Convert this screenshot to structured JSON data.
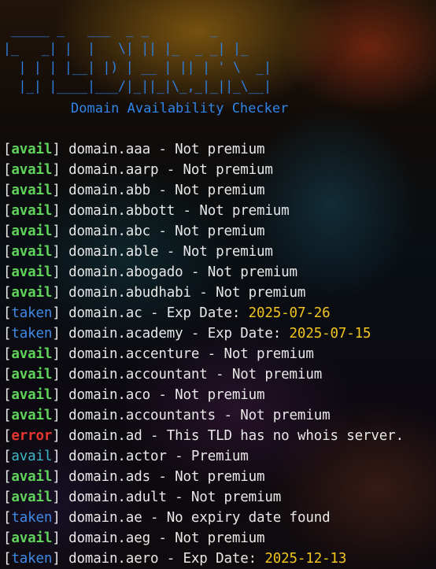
{
  "app": {
    "banner_ascii": " _____ _   ___  _ _        _\n|_   _| |  |   \\| || |_  _ _| |_\n  | | | |__| |) | __ | || | ' \\  _|\n  |_| |____|___/|_||_|\\_,_|_||_\\__|",
    "subtitle": "Domain Availability Checker"
  },
  "colors": {
    "avail": "#5fd35a",
    "avail_premium": "#3fb9c9",
    "taken": "#3f8ae6",
    "error": "#e8362f",
    "date": "#f0c51c",
    "banner": "#2e7fe0"
  },
  "lines": [
    {
      "status": "avail",
      "status_class": "avail",
      "domain": "domain.aaa",
      "message": "Not premium"
    },
    {
      "status": "avail",
      "status_class": "avail",
      "domain": "domain.aarp",
      "message": "Not premium"
    },
    {
      "status": "avail",
      "status_class": "avail",
      "domain": "domain.abb",
      "message": "Not premium"
    },
    {
      "status": "avail",
      "status_class": "avail",
      "domain": "domain.abbott",
      "message": "Not premium"
    },
    {
      "status": "avail",
      "status_class": "avail",
      "domain": "domain.abc",
      "message": "Not premium"
    },
    {
      "status": "avail",
      "status_class": "avail",
      "domain": "domain.able",
      "message": "Not premium"
    },
    {
      "status": "avail",
      "status_class": "avail",
      "domain": "domain.abogado",
      "message": "Not premium"
    },
    {
      "status": "avail",
      "status_class": "avail",
      "domain": "domain.abudhabi",
      "message": "Not premium"
    },
    {
      "status": "taken",
      "status_class": "taken",
      "domain": "domain.ac",
      "message": "Exp Date: ",
      "date": "2025-07-26"
    },
    {
      "status": "taken",
      "status_class": "taken",
      "domain": "domain.academy",
      "message": "Exp Date: ",
      "date": "2025-07-15"
    },
    {
      "status": "avail",
      "status_class": "avail",
      "domain": "domain.accenture",
      "message": "Not premium"
    },
    {
      "status": "avail",
      "status_class": "avail",
      "domain": "domain.accountant",
      "message": "Not premium"
    },
    {
      "status": "avail",
      "status_class": "avail",
      "domain": "domain.aco",
      "message": "Not premium"
    },
    {
      "status": "avail",
      "status_class": "avail",
      "domain": "domain.accountants",
      "message": "Not premium"
    },
    {
      "status": "error",
      "status_class": "error",
      "domain": "domain.ad",
      "message": "This TLD has no whois server."
    },
    {
      "status": "avail",
      "status_class": "avail-premium",
      "domain": "domain.actor",
      "message": "Premium"
    },
    {
      "status": "avail",
      "status_class": "avail",
      "domain": "domain.ads",
      "message": "Not premium"
    },
    {
      "status": "avail",
      "status_class": "avail",
      "domain": "domain.adult",
      "message": "Not premium"
    },
    {
      "status": "taken",
      "status_class": "taken",
      "domain": "domain.ae",
      "message": "No expiry date found"
    },
    {
      "status": "avail",
      "status_class": "avail",
      "domain": "domain.aeg",
      "message": "Not premium"
    },
    {
      "status": "taken",
      "status_class": "taken",
      "domain": "domain.aero",
      "message": "Exp Date: ",
      "date": "2025-12-13"
    }
  ]
}
